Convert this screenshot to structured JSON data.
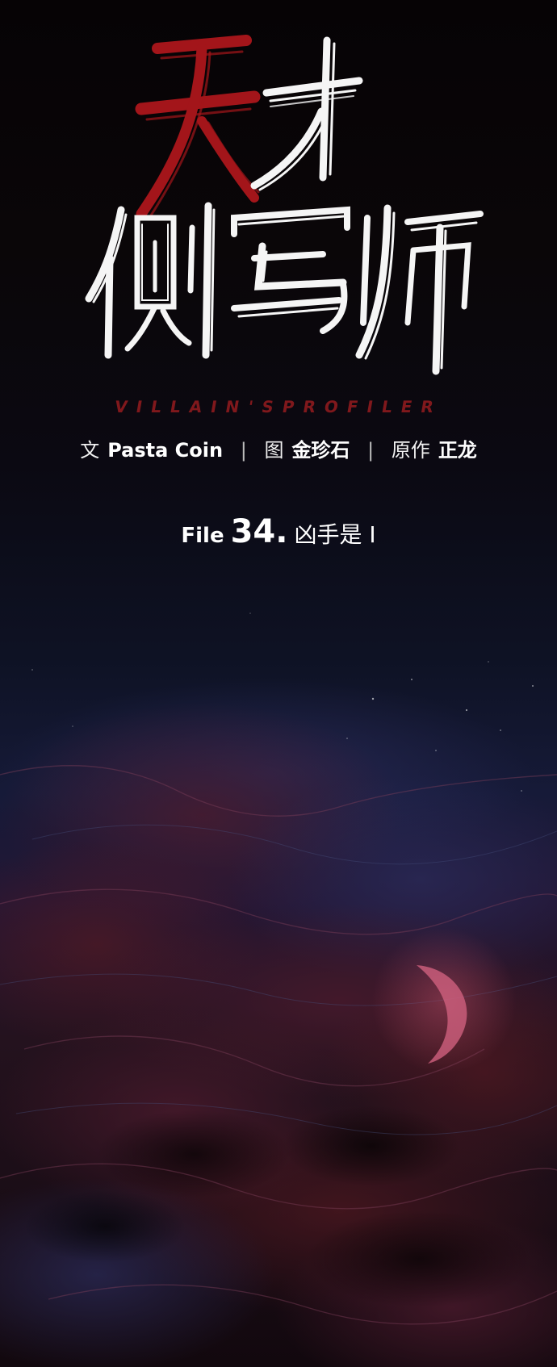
{
  "title": {
    "chinese": "天才侧写师",
    "english": "VILLAIN'SPROFILER"
  },
  "credits": [
    {
      "role": "文",
      "name": "Pasta Coin"
    },
    {
      "role": "图",
      "name": "金珍石"
    },
    {
      "role": "原作",
      "name": "正龙"
    }
  ],
  "separator": "|",
  "chapter": {
    "prefix": "File",
    "number": "34.",
    "title": "凶手是 I"
  },
  "colors": {
    "title_red": "#a3151a",
    "title_white": "#f5f5f5",
    "subtitle_red": "#8a1a1e",
    "text": "#ffffff"
  }
}
